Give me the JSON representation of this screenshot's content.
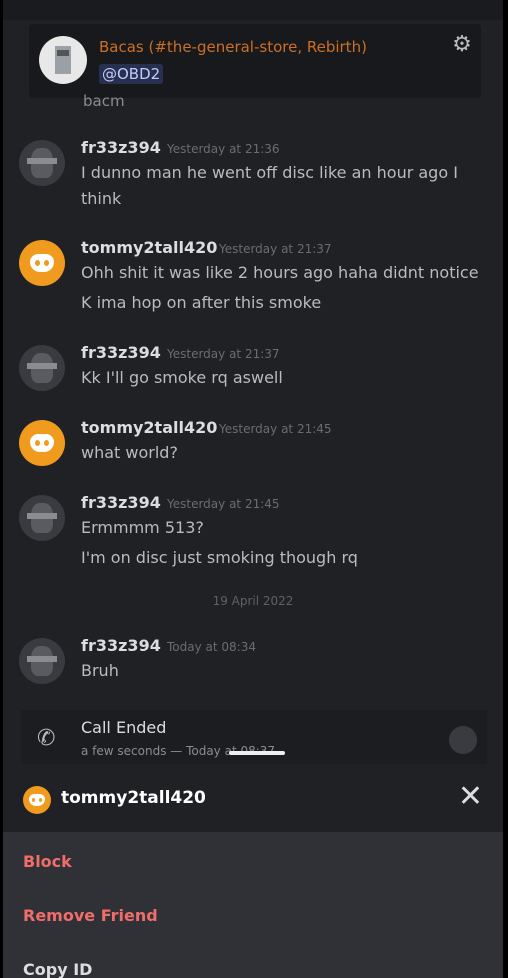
{
  "header": {
    "name": "Bacas (#the-general-store, Rebirth)",
    "mention": "@OBD2",
    "cutoff_text": "bacm"
  },
  "messages": [
    {
      "user": "fr33z394",
      "time": "Yesterday at 21:36",
      "avatar": "robot-avatar",
      "lines": [
        "I dunno man he went off disc like an hour ago I think"
      ]
    },
    {
      "user": "tommy2tall420",
      "time": "Yesterday at 21:37",
      "avatar": "discord-avatar",
      "lines": [
        "Ohh shit it was like 2 hours ago haha didnt notice",
        "K ima hop on after this smoke"
      ]
    },
    {
      "user": "fr33z394",
      "time": "Yesterday at 21:37",
      "avatar": "robot-avatar",
      "lines": [
        "Kk I'll go smoke rq aswell"
      ]
    },
    {
      "user": "tommy2tall420",
      "time": "Yesterday at 21:45",
      "avatar": "discord-avatar",
      "lines": [
        "what world?"
      ]
    },
    {
      "user": "fr33z394",
      "time": "Yesterday at 21:45",
      "avatar": "robot-avatar",
      "lines": [
        "Ermmmm 513?",
        "I'm on disc just smoking though rq"
      ]
    },
    {
      "user": "fr33z394",
      "time": "Today at 08:34",
      "avatar": "robot-avatar",
      "lines": [
        "Bruh"
      ]
    }
  ],
  "date_separator": "19 April 2022",
  "call": {
    "title": "Call Ended",
    "subtitle": "a few seconds — Today at 08:37"
  },
  "sheet": {
    "name": "tommy2tall420",
    "options": [
      "Block",
      "Remove Friend",
      "Copy ID"
    ]
  }
}
